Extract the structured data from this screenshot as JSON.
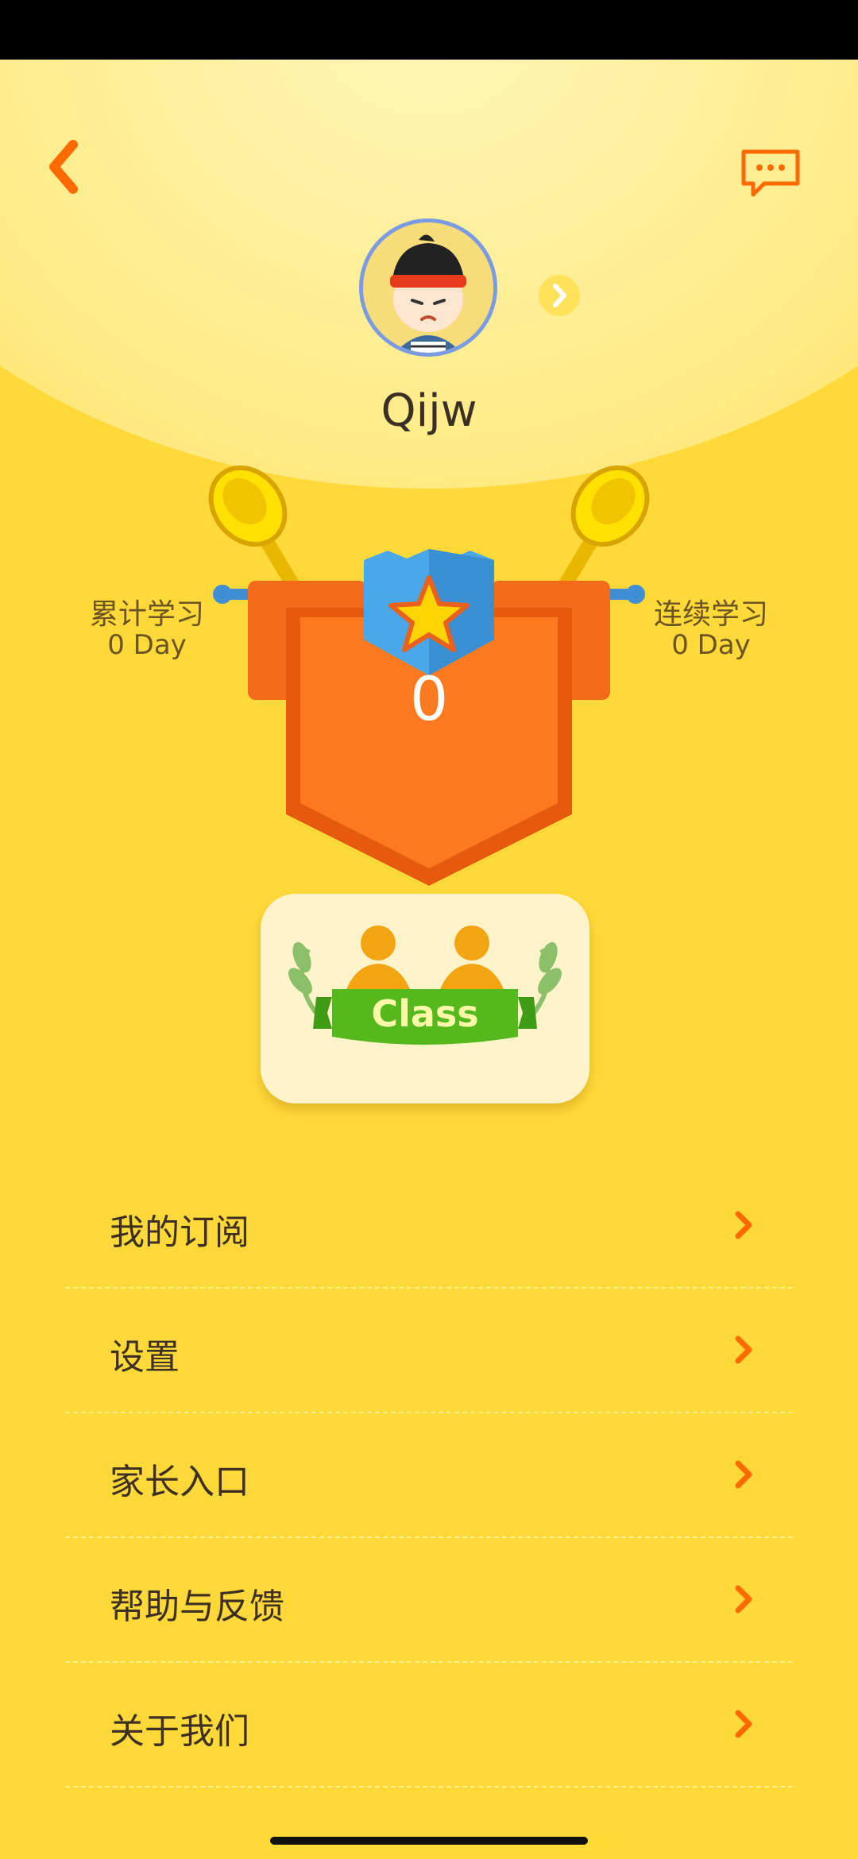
{
  "profile": {
    "username": "Qijw"
  },
  "stats": {
    "total_label": "累计学习",
    "total_value": "0 Day",
    "streak_label": "连续学习",
    "streak_value": "0 Day"
  },
  "badge": {
    "count": "0"
  },
  "class_card": {
    "label": "Class"
  },
  "menu": [
    {
      "label": "我的订阅"
    },
    {
      "label": "设置"
    },
    {
      "label": "家长入口"
    },
    {
      "label": "帮助与反馈"
    },
    {
      "label": "关于我们"
    }
  ],
  "icons": {
    "back": "chevron-left-icon",
    "message": "chat-bubble-icon",
    "menu_arrow": "chevron-right-icon"
  },
  "colors": {
    "background": "#ffd93a",
    "accent_orange": "#ff6a00",
    "text_dark": "#3d2f22"
  }
}
